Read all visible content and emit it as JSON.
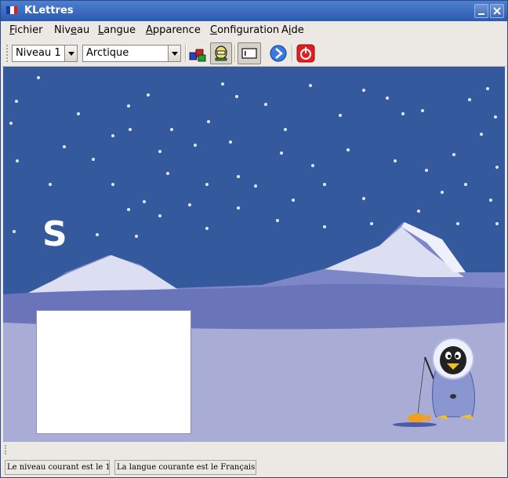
{
  "window": {
    "title": "KLettres"
  },
  "menubar": {
    "items": [
      {
        "label": "Fichier",
        "mnemonic_pre": "",
        "mnemonic": "F",
        "rest": "ichier"
      },
      {
        "label": "Niveau",
        "mnemonic_pre": "Niv",
        "mnemonic": "e",
        "rest": "au"
      },
      {
        "label": "Langue",
        "mnemonic_pre": "",
        "mnemonic": "L",
        "rest": "angue"
      },
      {
        "label": "Apparence",
        "mnemonic_pre": "",
        "mnemonic": "A",
        "rest": "pparence"
      },
      {
        "label": "Configuration",
        "mnemonic_pre": "",
        "mnemonic": "C",
        "rest": "onfiguration"
      },
      {
        "label": "Aide",
        "mnemonic_pre": "A",
        "mnemonic": "i",
        "rest": "de"
      }
    ]
  },
  "toolbar": {
    "level_combo": {
      "value": "Niveau 1"
    },
    "theme_combo": {
      "value": "Arctique"
    },
    "icons": [
      "blocks-icon",
      "grownup-icon",
      "menubar-toggle-icon",
      "next-icon",
      "quit-icon"
    ]
  },
  "game": {
    "letter": "S",
    "answer_value": ""
  },
  "statusbar": {
    "level_text": "Le niveau courant est le 1",
    "language_text": "La langue courante est le Français"
  },
  "colors": {
    "sky": "#35599d",
    "ice": "#a9add6",
    "titlebar": "#2b5bb0",
    "quit": "#e02020"
  }
}
